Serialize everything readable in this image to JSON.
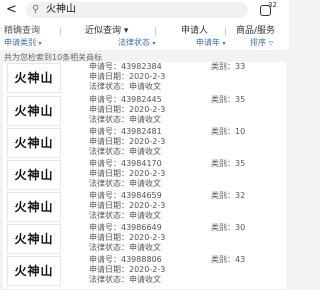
{
  "header": {
    "back_icon": "chevron-left",
    "search_icon": "magnifier",
    "query": "火神山",
    "ai_badge": "32"
  },
  "tabs": [
    {
      "label": "精确查询",
      "active": true
    },
    {
      "label": "近似查询 ▾",
      "active": false
    },
    {
      "label": "申请人",
      "active": false
    },
    {
      "label": "商品/服务",
      "active": false
    }
  ],
  "filters": [
    {
      "label": "申请类别",
      "arrow": "▾"
    },
    {
      "label": "法律状态",
      "arrow": "▾"
    },
    {
      "label": "申请年",
      "arrow": "▾"
    },
    {
      "label": "排序",
      "arrow": "▽"
    }
  ],
  "result_count": "共为您检索到10条相关商标",
  "labels": {
    "reg_no": "申请号：",
    "date": "申请日期：",
    "status": "法律状态：",
    "class": "类别："
  },
  "results": [
    {
      "logo_text": "火神山",
      "reg_no": "43982384",
      "date": "2020-2-3",
      "status": "申请收文",
      "class": "33"
    },
    {
      "logo_text": "火神山",
      "reg_no": "43982445",
      "date": "2020-2-3",
      "status": "申请收文",
      "class": "35"
    },
    {
      "logo_text": "火神山",
      "reg_no": "43982481",
      "date": "2020-2-3",
      "status": "申请收文",
      "class": "10"
    },
    {
      "logo_text": "火神山",
      "reg_no": "43984170",
      "date": "2020-2-3",
      "status": "申请收文",
      "class": "35"
    },
    {
      "logo_text": "火神山",
      "reg_no": "43984659",
      "date": "2020-2-3",
      "status": "申请收文",
      "class": "32"
    },
    {
      "logo_text": "火神山",
      "reg_no": "43986649",
      "date": "2020-2-3",
      "status": "申请收文",
      "class": "30"
    },
    {
      "logo_text": "火神山",
      "reg_no": "43988806",
      "date": "2020-2-3",
      "status": "申请收文",
      "class": "43"
    }
  ]
}
